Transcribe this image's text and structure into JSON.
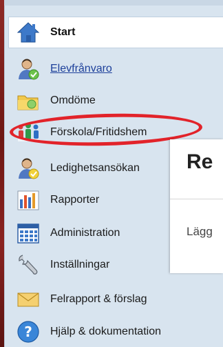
{
  "nav": {
    "items": [
      {
        "label": "Start",
        "icon": "home-icon"
      },
      {
        "label": "Elevfrånvaro",
        "icon": "student-absence-icon"
      },
      {
        "label": "Omdöme",
        "icon": "folder-icon"
      },
      {
        "label": "Förskola/Fritidshem",
        "icon": "children-icon"
      },
      {
        "label": "Ledighetsansökan",
        "icon": "leave-request-icon"
      },
      {
        "label": "Rapporter",
        "icon": "bar-chart-icon"
      },
      {
        "label": "Administration",
        "icon": "calendar-grid-icon"
      },
      {
        "label": "Inställningar",
        "icon": "wrench-icon"
      },
      {
        "label": "Felrapport & förslag",
        "icon": "envelope-icon"
      },
      {
        "label": "Hjälp & dokumentation",
        "icon": "help-icon"
      }
    ]
  },
  "panel": {
    "title": "Re",
    "body": "Lägg"
  },
  "colors": {
    "sidebar_bg": "#d8e4ef",
    "highlight": "#e2232a",
    "link": "#1c3f9a"
  }
}
